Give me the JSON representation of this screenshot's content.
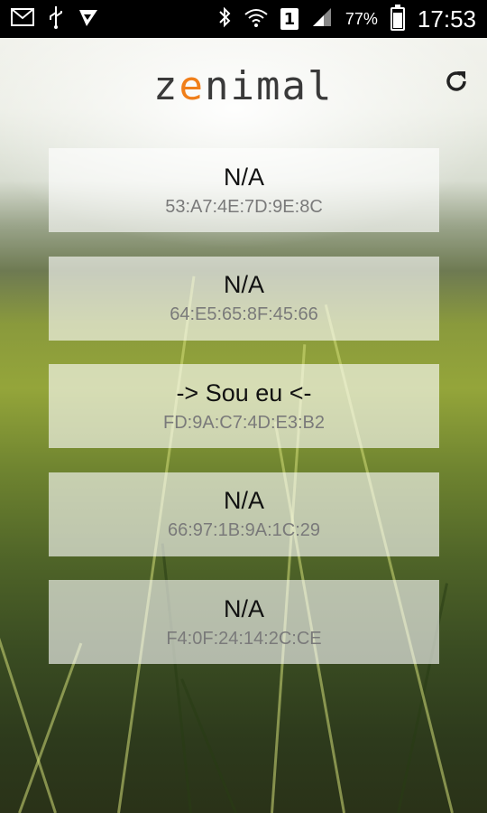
{
  "statusbar": {
    "left_icons": [
      "mail-icon",
      "usb-icon",
      "shopping-bag-icon"
    ],
    "sim_label": "1",
    "battery_text": "77%",
    "battery_level": 0.77,
    "time": "17:53"
  },
  "header": {
    "logo_prefix": "z",
    "logo_accent": "e",
    "logo_suffix": "nimal",
    "accent_color": "#f07f1a",
    "refresh_icon": "refresh-icon"
  },
  "devices": [
    {
      "name": "N/A",
      "mac": "53:A7:4E:7D:9E:8C"
    },
    {
      "name": "N/A",
      "mac": "64:E5:65:8F:45:66"
    },
    {
      "name": "-> Sou eu <-",
      "mac": "FD:9A:C7:4D:E3:B2"
    },
    {
      "name": "N/A",
      "mac": "66:97:1B:9A:1C:29"
    },
    {
      "name": "N/A",
      "mac": "F4:0F:24:14:2C:CE"
    }
  ]
}
